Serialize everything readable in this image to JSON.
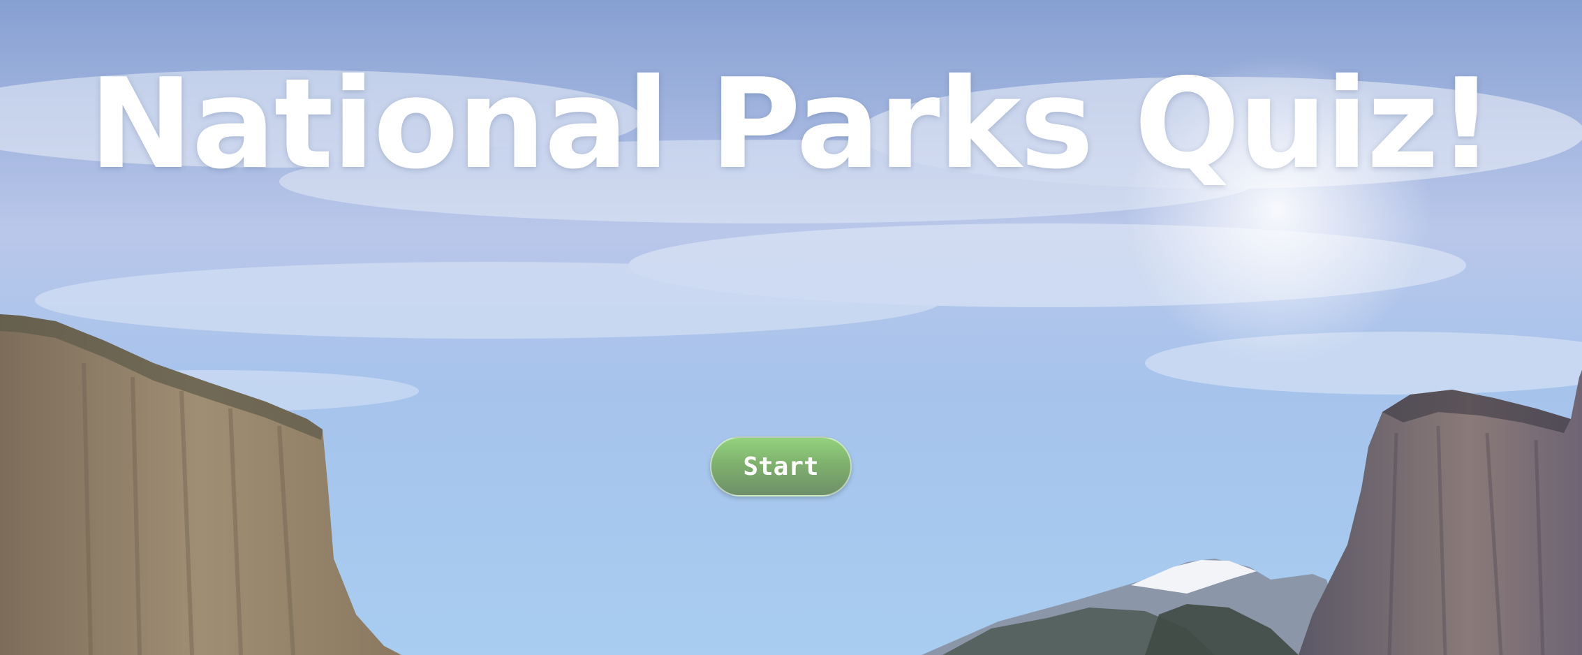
{
  "page": {
    "title": "National Parks Quiz!"
  },
  "actions": {
    "start_label": "Start"
  },
  "colors": {
    "sky_top": "#8fa9d6",
    "sky_bottom": "#a9cdef",
    "button_top": "#93d27e",
    "button_bottom": "#6e8f68",
    "text": "#ffffff"
  },
  "background": {
    "icon": "landscape-mountains"
  }
}
